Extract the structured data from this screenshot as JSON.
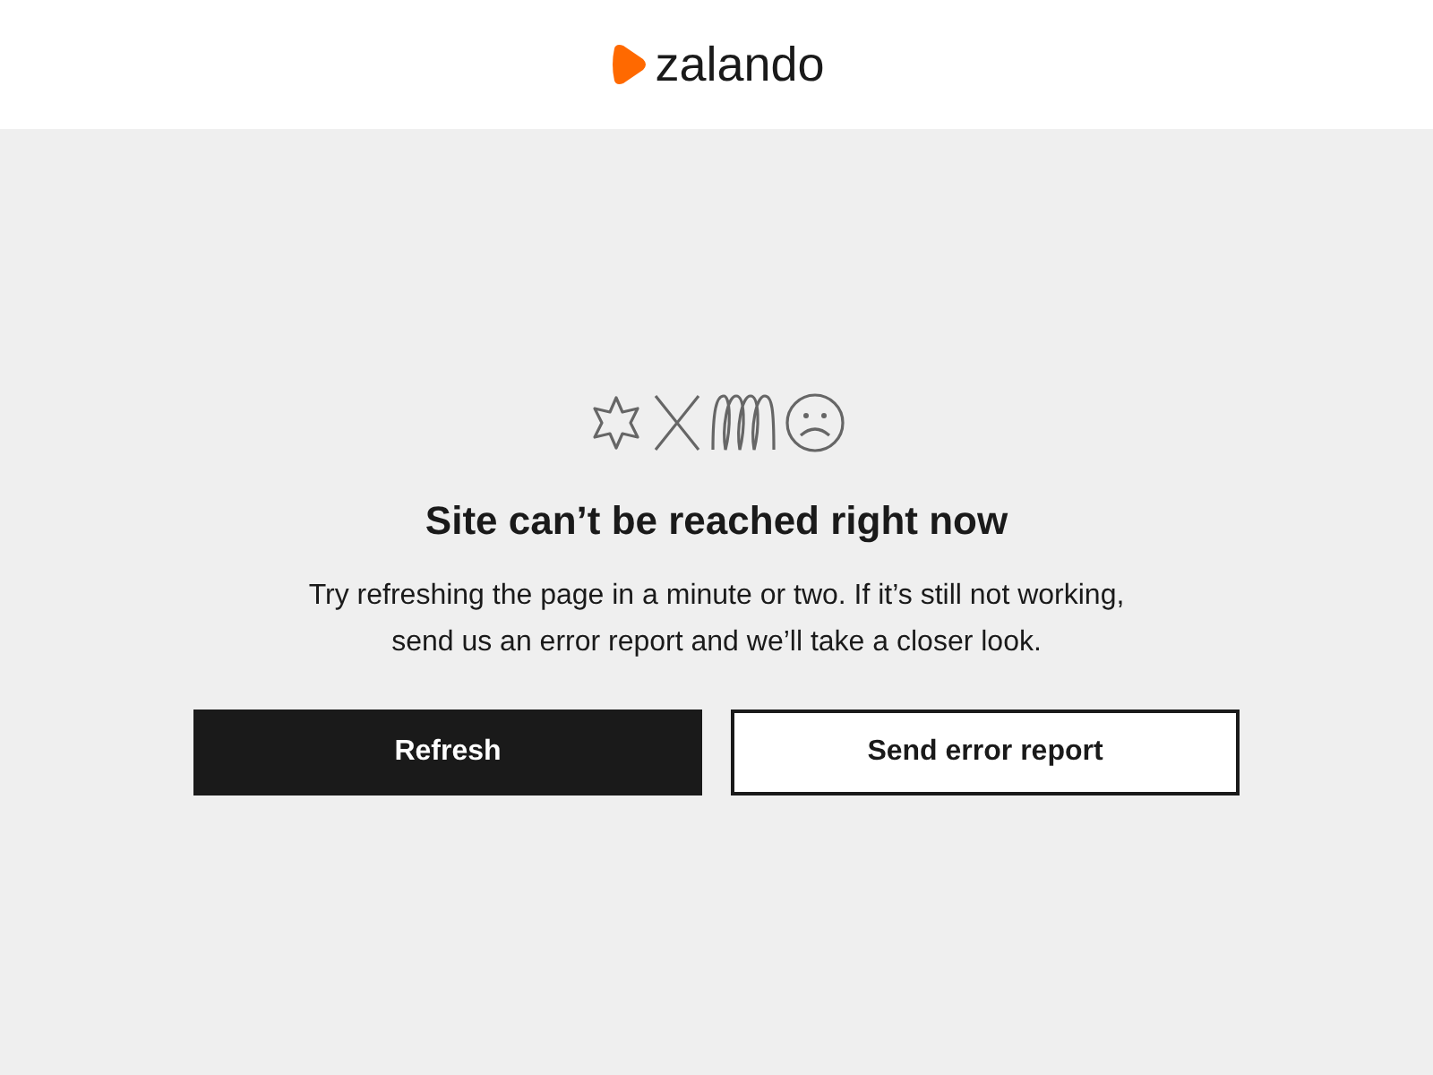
{
  "header": {
    "logo_text": "zalando"
  },
  "error": {
    "title": "Site can’t be reached right now",
    "message": "Try refreshing the page in a minute or two. If it’s still not working, send us an error report and we’ll take a closer look."
  },
  "buttons": [
    {
      "label": "Refresh",
      "kind": "primary"
    },
    {
      "label": "Send error report",
      "kind": "secondary"
    }
  ]
}
